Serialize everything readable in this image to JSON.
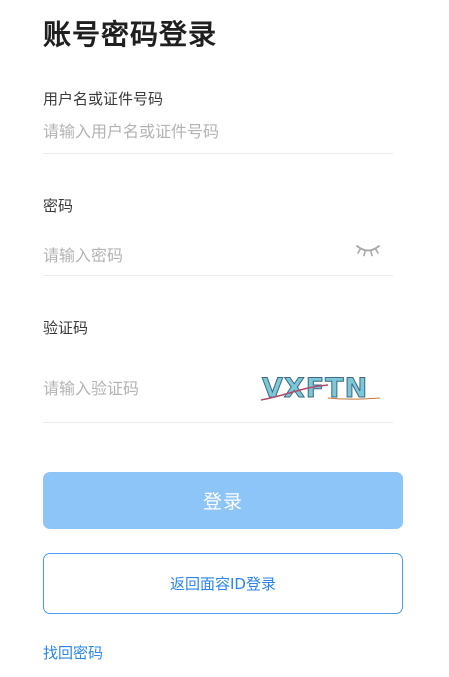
{
  "header": {
    "title": "账号密码登录"
  },
  "username": {
    "label": "用户名或证件号码",
    "placeholder": "请输入用户名或证件号码"
  },
  "password": {
    "label": "密码",
    "placeholder": "请输入密码",
    "toggle_icon": "eye-closed-icon"
  },
  "captcha": {
    "label": "验证码",
    "placeholder": "请输入验证码",
    "image_text": "VXFTN"
  },
  "actions": {
    "login_label": "登录",
    "face_id_label": "返回面容ID登录",
    "forgot_label": "找回密码"
  },
  "colors": {
    "primary": "#2a86e8",
    "button_disabled": "#8ec5f9",
    "placeholder": "#b3b3b3",
    "divider": "#ececec"
  }
}
